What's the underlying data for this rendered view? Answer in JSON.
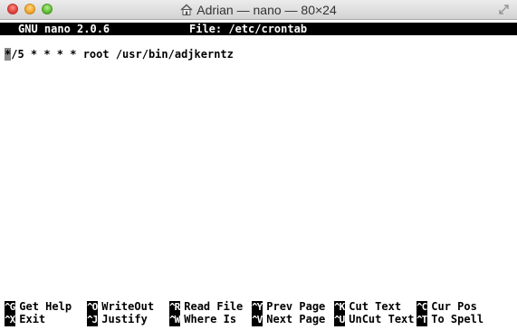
{
  "window": {
    "title": "Adrian — nano — 80×24",
    "icons": {
      "title": "house-icon",
      "resize": "resize-icon",
      "close": "close-icon",
      "minimize": "minimize-icon",
      "zoom": "zoom-icon"
    }
  },
  "nano": {
    "version": "GNU nano 2.0.6",
    "file": "File: /etc/crontab"
  },
  "editor": {
    "cursor_char": "*",
    "line1_rest": "/5 * * * * root /usr/bin/adjkerntz"
  },
  "shortcuts": {
    "row1": [
      {
        "key": "^G",
        "label": "Get Help"
      },
      {
        "key": "^O",
        "label": "WriteOut"
      },
      {
        "key": "^R",
        "label": "Read File"
      },
      {
        "key": "^Y",
        "label": "Prev Page"
      },
      {
        "key": "^K",
        "label": "Cut Text"
      },
      {
        "key": "^C",
        "label": "Cur Pos"
      }
    ],
    "row2": [
      {
        "key": "^X",
        "label": "Exit"
      },
      {
        "key": "^J",
        "label": "Justify"
      },
      {
        "key": "^W",
        "label": "Where Is"
      },
      {
        "key": "^V",
        "label": "Next Page"
      },
      {
        "key": "^U",
        "label": "UnCut Text"
      },
      {
        "key": "^T",
        "label": "To Spell"
      }
    ]
  }
}
